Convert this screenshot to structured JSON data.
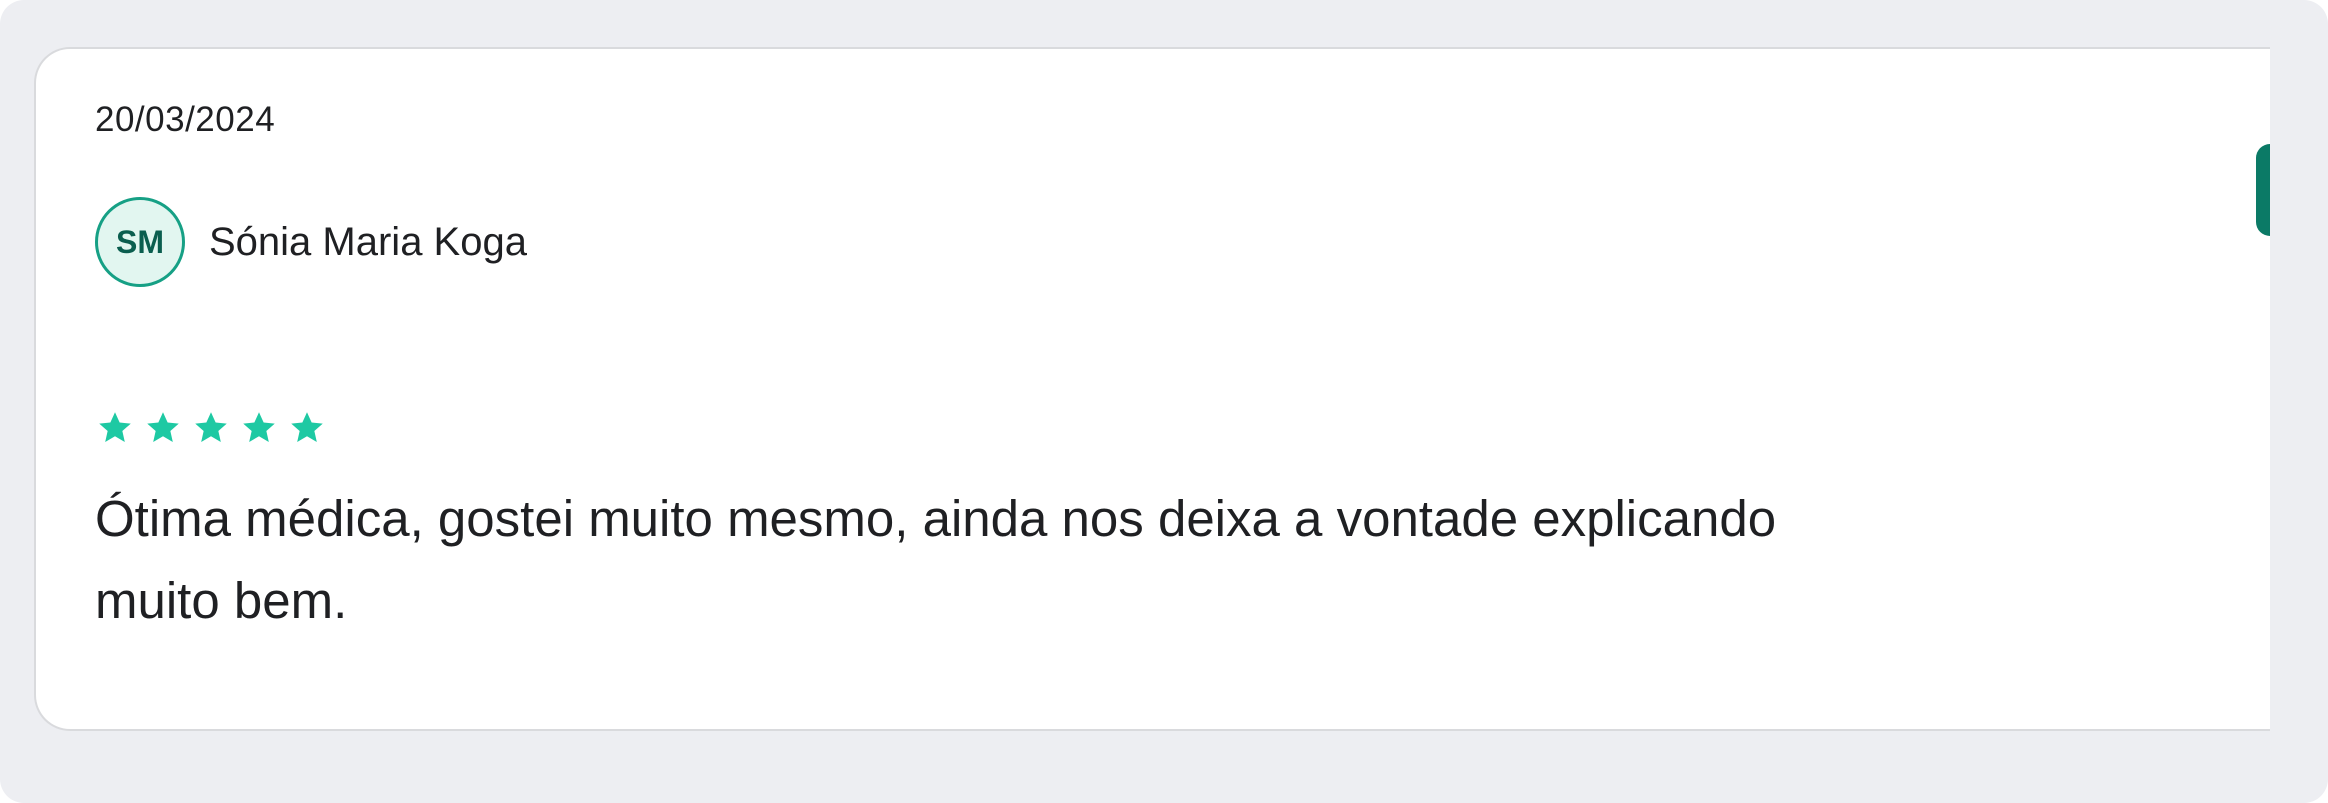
{
  "review": {
    "date": "20/03/2024",
    "reviewer": {
      "initials": "SM",
      "name": "Sónia Maria Koga"
    },
    "rating": 5,
    "text_line1": "Ótima médica, gostei muito mesmo, ainda nos deixa a vontade explicando",
    "text_line2": "muito bem."
  },
  "colors": {
    "background": "#edeef2",
    "card": "#ffffff",
    "accent": "#16a085",
    "star": "#1ec9a3",
    "edge_tab": "#0b7a66",
    "text": "#1f2023"
  }
}
